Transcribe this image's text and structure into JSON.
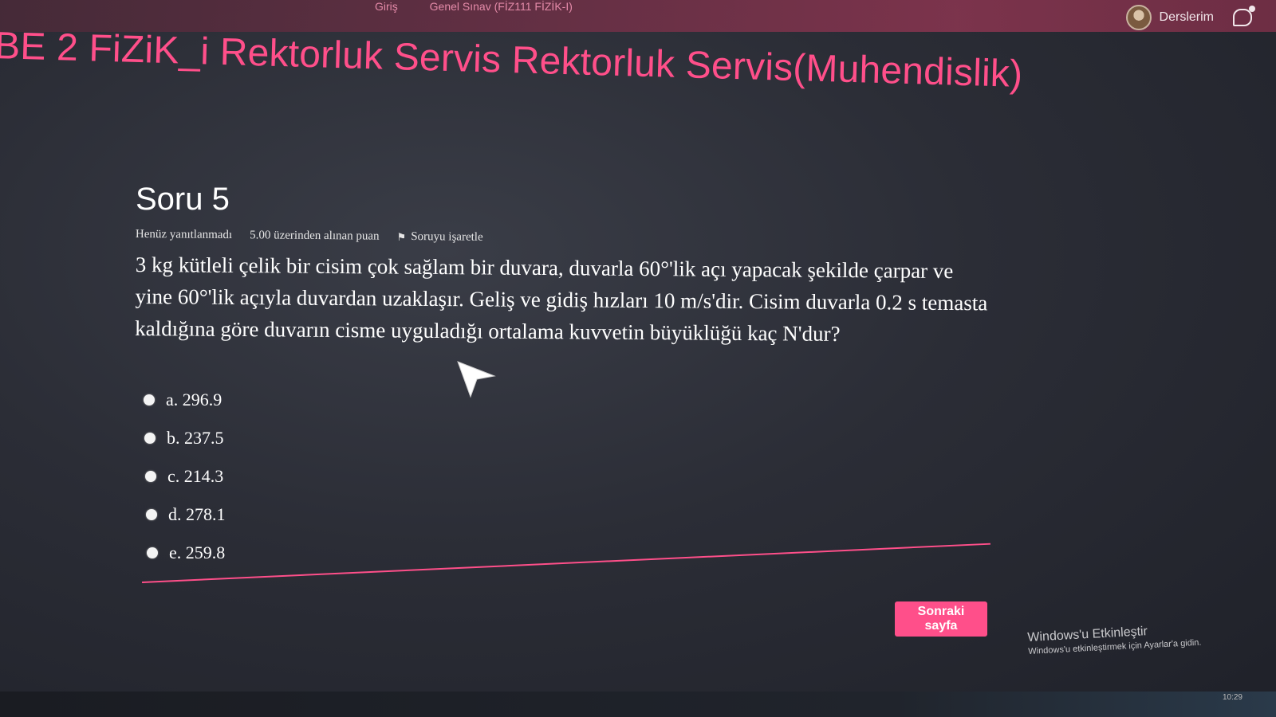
{
  "header": {
    "breadcrumb": [
      "Giriş",
      "Genel Sınav (FİZ111 FİZİK-I)"
    ],
    "user_label": "Derslerim",
    "avatar_icon": "user-avatar",
    "message_icon": "chat-icon"
  },
  "course_title": "BE 2 FiZiK_i Rektorluk Servis Rektorluk Servis(Muhendislik)",
  "question": {
    "heading": "Soru 5",
    "status": "Henüz yanıtlanmadı",
    "points": "5.00 üzerinden alınan puan",
    "flag_label": "Soruyu işaretle",
    "flag_icon": "flag-icon",
    "text": "3 kg kütleli çelik bir cisim çok sağlam bir duvara, duvarla 60°'lik açı yapacak şekilde çarpar ve yine 60°'lik açıyla duvardan uzaklaşır. Geliş ve gidiş hızları 10 m/s'dir. Cisim duvarla 0.2 s temasta kaldığına göre duvarın cisme uyguladığı ortalama kuvvetin büyüklüğü kaç N'dur?",
    "options": [
      {
        "label": "a. 296.9"
      },
      {
        "label": "b. 237.5"
      },
      {
        "label": "c. 214.3"
      },
      {
        "label": "d. 278.1"
      },
      {
        "label": "e. 259.8"
      }
    ]
  },
  "next_button": "Sonraki sayfa",
  "activation": {
    "title": "Windows'u Etkinleştir",
    "subtitle": "Windows'u etkinleştirmek için Ayarlar'a gidin."
  },
  "taskbar": {
    "clock": "10:29"
  },
  "colors": {
    "accent": "#ff4f8a",
    "background": "#2b2d36",
    "text": "#ffffff"
  }
}
